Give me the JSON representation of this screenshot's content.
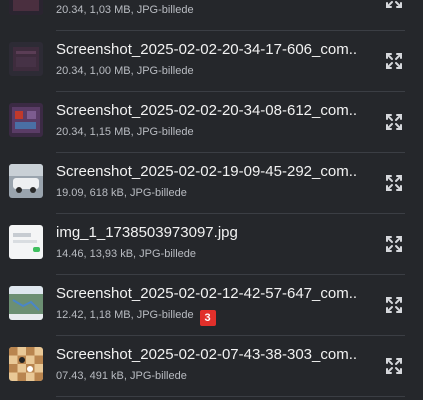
{
  "files": [
    {
      "title": "",
      "meta": "20.34, 1,03 MB, JPG-billede",
      "thumb": "screenshot-dark"
    },
    {
      "title": "Screenshot_2025-02-02-20-34-17-606_com....",
      "meta": "20.34, 1,00 MB, JPG-billede",
      "thumb": "screenshot-dark"
    },
    {
      "title": "Screenshot_2025-02-02-20-34-08-612_com....",
      "meta": "20.34, 1,15 MB, JPG-billede",
      "thumb": "screenshot-purple"
    },
    {
      "title": "Screenshot_2025-02-02-19-09-45-292_com....",
      "meta": "19.09, 618 kB, JPG-billede",
      "thumb": "screenshot-car"
    },
    {
      "title": "img_1_1738503973097.jpg",
      "meta": "14.46, 13,93 kB, JPG-billede",
      "thumb": "image-white"
    },
    {
      "title": "Screenshot_2025-02-02-12-42-57-647_com....",
      "meta": "12.42, 1,18 MB, JPG-billede",
      "thumb": "screenshot-map",
      "badge": "3"
    },
    {
      "title": "Screenshot_2025-02-02-07-43-38-303_com....",
      "meta": "07.43, 491 kB, JPG-billede",
      "thumb": "screenshot-chess"
    }
  ],
  "colors": {
    "background": "#25272b",
    "badge": "#e1302b"
  }
}
